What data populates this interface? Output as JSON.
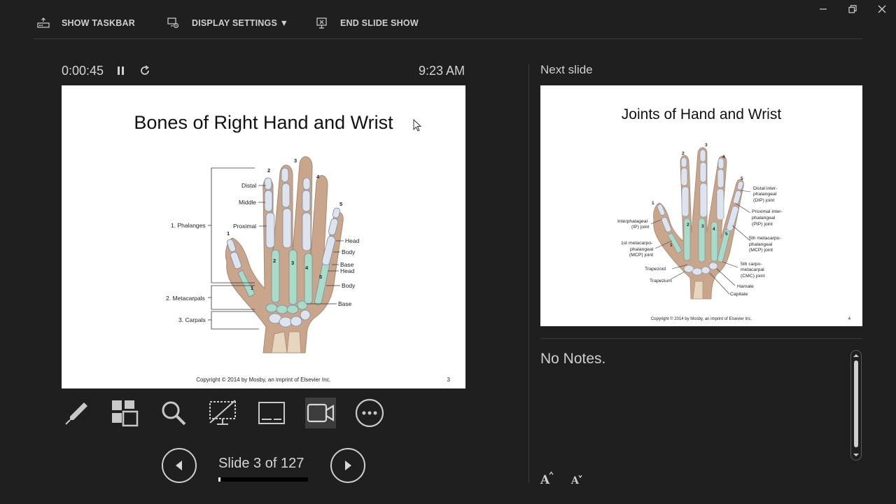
{
  "toolbar": {
    "show_taskbar": "SHOW TASKBAR",
    "display_settings": "DISPLAY SETTINGS ▼",
    "end_slide_show": "END SLIDE SHOW"
  },
  "presenter": {
    "timer": "0:00:45",
    "clock": "9:23 AM",
    "slide_counter": "Slide 3 of 127",
    "progress_fraction": 0.024
  },
  "current_slide": {
    "title": "Bones of Right Hand and Wrist",
    "copyright": "Copyright © 2014 by Mosby, an imprint of Elsevier Inc.",
    "number": "3",
    "labels": {
      "phalanges": "1. Phalanges",
      "metacarpals": "2. Metacarpals",
      "carpals": "3. Carpals",
      "distal": "Distal",
      "middle": "Middle",
      "proximal": "Proximal",
      "head1": "Head",
      "body1": "Body",
      "base1": "Base",
      "head2": "Head",
      "body2": "Body",
      "base2": "Base",
      "n1": "1",
      "n2": "2",
      "n3": "3",
      "n4": "4",
      "n5": "5",
      "m1": "1",
      "m2": "2",
      "m3": "3",
      "m4": "4",
      "m5": "5"
    }
  },
  "next": {
    "label": "Next slide",
    "title": "Joints of Hand and Wrist",
    "copyright": "Copyright © 2014 by Mosby, an imprint of Elsevier Inc.",
    "number": "4",
    "labels": {
      "dip1": "Distal inter-",
      "dip2": "phalangeal",
      "dip3": "(DIP) joint",
      "pip1": "Proximal inter-",
      "pip2": "phalangeal",
      "pip3": "(PIP) joint",
      "mcp5a": "5th metacarpo-",
      "mcp5b": "phalangeal",
      "mcp5c": "(MCP) joint",
      "cmc1": "5th carpo-",
      "cmc2": "metacarpal",
      "cmc3": "(CMC) joint",
      "hamate": "Hamate",
      "capitate": "Capitate",
      "ip1": "Interphalageal",
      "ip2": "(IP) joint",
      "mcp1a": "1st metacarpo-",
      "mcp1b": "phalangeal",
      "mcp1c": "(MCP) joint",
      "trapezoid": "Trapezoid",
      "trapezium": "Trapezium",
      "n1": "1",
      "n2": "2",
      "n3": "3",
      "n4": "4",
      "n5": "5",
      "m2": "2",
      "m3": "3",
      "m4": "4",
      "m5": "5",
      "m1": "1"
    }
  },
  "notes": {
    "text": "No Notes."
  },
  "colors": {
    "background": "#1f1f1f",
    "skin": "#c9a58c",
    "bone": "#dde4ee",
    "joint": "#a9dcc8"
  }
}
